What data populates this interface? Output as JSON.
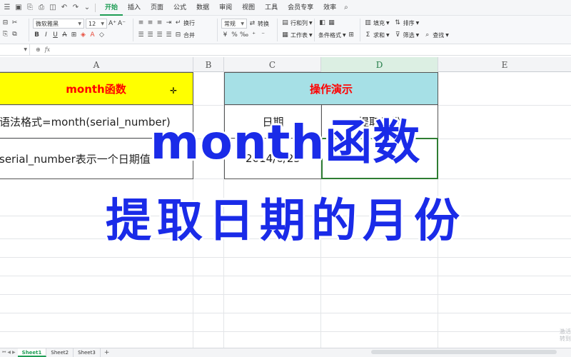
{
  "menubar": {
    "tabs": [
      "开始",
      "插入",
      "页面",
      "公式",
      "数据",
      "审阅",
      "视图",
      "工具",
      "会员专享",
      "效率"
    ],
    "active_tab": "开始"
  },
  "ribbon": {
    "font_name": "微软雅黑",
    "font_size": "12",
    "number_format": "常规",
    "wrap": "换行",
    "convert": "转换",
    "merge": "合并",
    "row_col": "行和列",
    "worksheet": "工作表",
    "conditional_format": "条件格式",
    "fill": "填充",
    "sum": "求和",
    "filter": "筛选",
    "sort": "排序",
    "find": "查找"
  },
  "formula_bar": {
    "fx": "fx"
  },
  "columns": [
    "A",
    "B",
    "C",
    "D",
    "E"
  ],
  "selected_column": "D",
  "cells": {
    "a1": "month函数",
    "a2": "语法格式=month(serial_number)",
    "a3": "serial_number表示一个日期值",
    "c1": "操作演示",
    "c2": "日期",
    "d2": "提取月份",
    "c3": "2014/6/25"
  },
  "overlay": {
    "line1": "month函数",
    "line2": "提取日期的月份"
  },
  "watermark": "激活 转到",
  "sheets": [
    "Sheet1",
    "Sheet2",
    "Sheet3"
  ],
  "active_sheet": "Sheet1",
  "colors": {
    "accent": "#1f9d55",
    "header_yellow": "#ffff00",
    "header_teal": "#a6e0e6",
    "header_text": "#ff0000",
    "overlay_text": "#1a2be8",
    "selection_border": "#2e7d32"
  }
}
